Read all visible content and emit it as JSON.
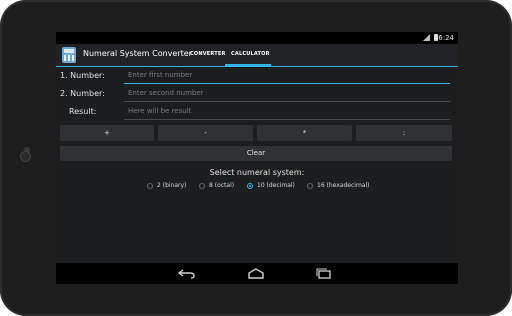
{
  "status_bar": {
    "time": "16:24"
  },
  "action_bar": {
    "title": "Numeral System Converter",
    "tabs": [
      {
        "label": "CONVERTER",
        "selected": false
      },
      {
        "label": "CALCULATOR",
        "selected": true
      }
    ],
    "accent_color": "#33b5e5"
  },
  "form": {
    "number1_label": "1. Number:",
    "number1_placeholder": "Enter first number",
    "number2_label": "2. Number:",
    "number2_placeholder": "Enter second number",
    "result_label": "Result:",
    "result_placeholder": "Here will be result"
  },
  "operations": [
    "+",
    "-",
    "*",
    ":"
  ],
  "clear_label": "Clear",
  "numeral_system": {
    "title": "Select numeral system:",
    "options": [
      "2 (binary)",
      "8 (octal)",
      "10 (decimal)",
      "16 (hexadecimal)"
    ],
    "selected_index": 2
  },
  "nav_icons": [
    "back-icon",
    "home-icon",
    "recents-icon"
  ]
}
